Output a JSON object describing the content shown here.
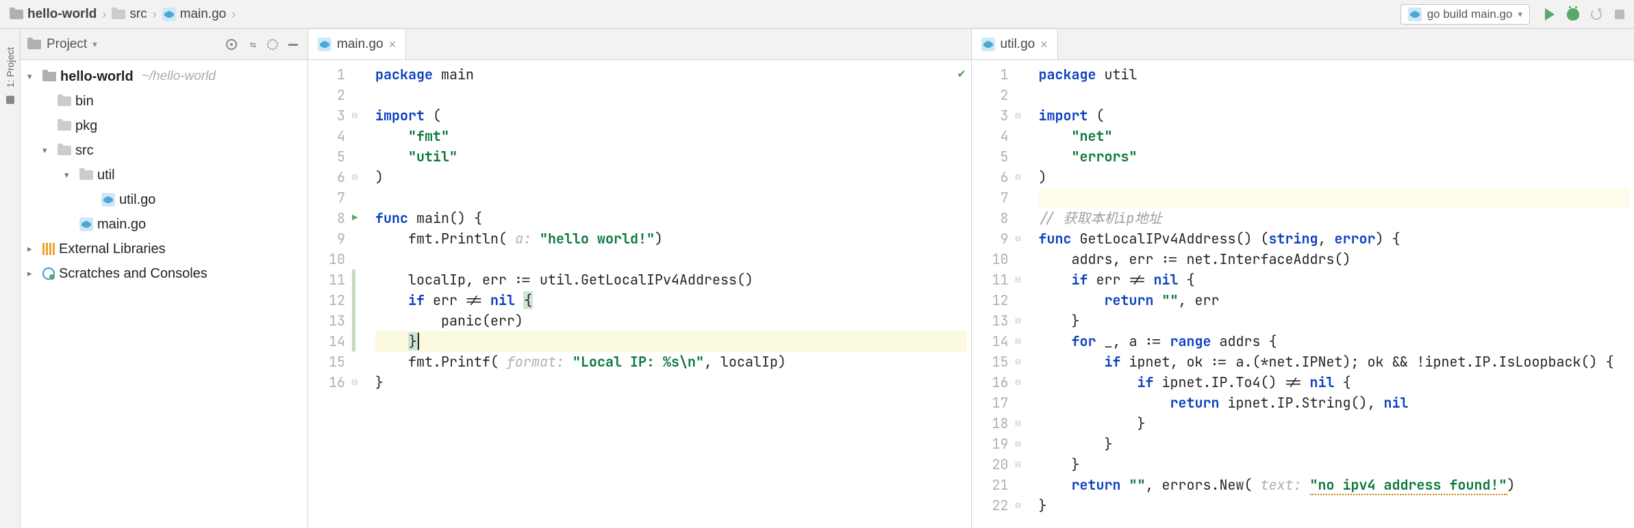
{
  "breadcrumbs": [
    {
      "label": "hello-world",
      "icon": "folder",
      "bold": true
    },
    {
      "label": "src",
      "icon": "folder",
      "bold": false
    },
    {
      "label": "main.go",
      "icon": "go",
      "bold": false
    }
  ],
  "run_config": {
    "label": "go build main.go",
    "icon": "go"
  },
  "toolbar_icons": [
    "play",
    "bug",
    "rerun",
    "stop"
  ],
  "gutter_tab": {
    "label": "1: Project"
  },
  "project_header": {
    "title": "Project"
  },
  "project_tree": [
    {
      "depth": 0,
      "arrow": "▾",
      "icon": "folder-dark",
      "name": "hello-world",
      "bold": true,
      "hint": "~/hello-world"
    },
    {
      "depth": 1,
      "arrow": "",
      "icon": "folder",
      "name": "bin"
    },
    {
      "depth": 1,
      "arrow": "",
      "icon": "folder",
      "name": "pkg"
    },
    {
      "depth": 1,
      "arrow": "▾",
      "icon": "folder",
      "name": "src"
    },
    {
      "depth": 2,
      "arrow": "▾",
      "icon": "folder",
      "name": "util"
    },
    {
      "depth": 3,
      "arrow": "",
      "icon": "go",
      "name": "util.go"
    },
    {
      "depth": 2,
      "arrow": "",
      "icon": "go",
      "name": "main.go"
    },
    {
      "depth": 0,
      "arrow": "▸",
      "icon": "lib",
      "name": "External Libraries"
    },
    {
      "depth": 0,
      "arrow": "▸",
      "icon": "scratch",
      "name": "Scratches and Consoles"
    }
  ],
  "editors": [
    {
      "tab": {
        "name": "main.go",
        "icon": "go"
      },
      "checkmark": true,
      "modif_range": [
        11,
        14
      ],
      "caret_line": 14,
      "run_mark_line": 8,
      "lines": [
        {
          "n": 1,
          "tokens": [
            [
              "kw",
              "package "
            ],
            [
              "pkg",
              "main"
            ]
          ]
        },
        {
          "n": 2,
          "tokens": []
        },
        {
          "n": 3,
          "fold": "-",
          "tokens": [
            [
              "kw",
              "import "
            ],
            [
              "",
              "("
            ]
          ]
        },
        {
          "n": 4,
          "tokens": [
            [
              "",
              "    "
            ],
            [
              "str",
              "\"fmt\""
            ]
          ]
        },
        {
          "n": 5,
          "tokens": [
            [
              "",
              "    "
            ],
            [
              "str",
              "\"util\""
            ]
          ]
        },
        {
          "n": 6,
          "fold": "-",
          "tokens": [
            [
              "",
              ")"
            ]
          ]
        },
        {
          "n": 7,
          "tokens": []
        },
        {
          "n": 8,
          "fold": "-",
          "tokens": [
            [
              "kw",
              "func "
            ],
            [
              "fn",
              "main"
            ],
            [
              "",
              "() {"
            ]
          ]
        },
        {
          "n": 9,
          "tokens": [
            [
              "",
              "    fmt.Println( "
            ],
            [
              "hint",
              "a: "
            ],
            [
              "str",
              "\"hello world!\""
            ],
            [
              "",
              ")"
            ]
          ]
        },
        {
          "n": 10,
          "tokens": []
        },
        {
          "n": 11,
          "tokens": [
            [
              "",
              "    localIp, err := util.GetLocalIPv4Address()"
            ]
          ]
        },
        {
          "n": 12,
          "tokens": [
            [
              "",
              "    "
            ],
            [
              "kw",
              "if "
            ],
            [
              "",
              "err != "
            ],
            [
              "kw",
              "nil "
            ],
            [
              "brace",
              "{"
            ]
          ]
        },
        {
          "n": 13,
          "tokens": [
            [
              "",
              "        panic(err)"
            ]
          ]
        },
        {
          "n": 14,
          "hl": true,
          "tokens": [
            [
              "",
              "    "
            ],
            [
              "brace caret",
              "}"
            ]
          ]
        },
        {
          "n": 15,
          "tokens": [
            [
              "",
              "    fmt.Printf( "
            ],
            [
              "hint",
              "format: "
            ],
            [
              "str",
              "\"Local IP: %s\\n\""
            ],
            [
              "",
              ", localIp)"
            ]
          ]
        },
        {
          "n": 16,
          "fold": "-",
          "tokens": [
            [
              "",
              "}"
            ]
          ]
        }
      ]
    },
    {
      "tab": {
        "name": "util.go",
        "icon": "go"
      },
      "checkmark": false,
      "caret_line": 0,
      "lines": [
        {
          "n": 1,
          "tokens": [
            [
              "kw",
              "package "
            ],
            [
              "pkg",
              "util"
            ]
          ]
        },
        {
          "n": 2,
          "tokens": []
        },
        {
          "n": 3,
          "fold": "-",
          "tokens": [
            [
              "kw",
              "import "
            ],
            [
              "",
              "("
            ]
          ]
        },
        {
          "n": 4,
          "tokens": [
            [
              "",
              "    "
            ],
            [
              "str",
              "\"net\""
            ]
          ]
        },
        {
          "n": 5,
          "tokens": [
            [
              "",
              "    "
            ],
            [
              "str",
              "\"errors\""
            ]
          ]
        },
        {
          "n": 6,
          "fold": "-",
          "tokens": [
            [
              "",
              ")"
            ]
          ]
        },
        {
          "n": 7,
          "hl": "soft",
          "tokens": []
        },
        {
          "n": 8,
          "tokens": [
            [
              "cmt",
              "// 获取本机ip地址"
            ]
          ]
        },
        {
          "n": 9,
          "fold": "-",
          "tokens": [
            [
              "kw",
              "func "
            ],
            [
              "fn",
              "GetLocalIPv4Address"
            ],
            [
              "",
              "() ("
            ],
            [
              "kw",
              "string"
            ],
            [
              "",
              ", "
            ],
            [
              "kw",
              "error"
            ],
            [
              "",
              ") {"
            ]
          ]
        },
        {
          "n": 10,
          "tokens": [
            [
              "",
              "    addrs, err := net.InterfaceAddrs()"
            ]
          ]
        },
        {
          "n": 11,
          "fold": "-",
          "tokens": [
            [
              "",
              "    "
            ],
            [
              "kw",
              "if "
            ],
            [
              "",
              "err != "
            ],
            [
              "kw",
              "nil"
            ],
            [
              "",
              " {"
            ]
          ]
        },
        {
          "n": 12,
          "tokens": [
            [
              "",
              "        "
            ],
            [
              "kw",
              "return "
            ],
            [
              "str",
              "\"\""
            ],
            [
              "",
              ", err"
            ]
          ]
        },
        {
          "n": 13,
          "fold": "-",
          "tokens": [
            [
              "",
              "    }"
            ]
          ]
        },
        {
          "n": 14,
          "fold": "-",
          "tokens": [
            [
              "",
              "    "
            ],
            [
              "kw",
              "for "
            ],
            [
              "",
              "_, a := "
            ],
            [
              "kw",
              "range "
            ],
            [
              "",
              "addrs {"
            ]
          ]
        },
        {
          "n": 15,
          "fold": "-",
          "tokens": [
            [
              "",
              "        "
            ],
            [
              "kw",
              "if "
            ],
            [
              "",
              "ipnet, ok := a.(*net.IPNet); ok && !ipnet.IP.IsLoopback() {"
            ]
          ]
        },
        {
          "n": 16,
          "fold": "-",
          "tokens": [
            [
              "",
              "            "
            ],
            [
              "kw",
              "if "
            ],
            [
              "",
              "ipnet.IP.To4() != "
            ],
            [
              "kw",
              "nil"
            ],
            [
              "",
              " {"
            ]
          ]
        },
        {
          "n": 17,
          "tokens": [
            [
              "",
              "                "
            ],
            [
              "kw",
              "return "
            ],
            [
              "",
              "ipnet.IP.String(), "
            ],
            [
              "kw",
              "nil"
            ]
          ]
        },
        {
          "n": 18,
          "fold": "-",
          "tokens": [
            [
              "",
              "            }"
            ]
          ]
        },
        {
          "n": 19,
          "fold": "-",
          "tokens": [
            [
              "",
              "        }"
            ]
          ]
        },
        {
          "n": 20,
          "fold": "-",
          "tokens": [
            [
              "",
              "    }"
            ]
          ]
        },
        {
          "n": 21,
          "tokens": [
            [
              "",
              "    "
            ],
            [
              "kw",
              "return "
            ],
            [
              "str",
              "\"\""
            ],
            [
              "",
              ", errors.New( "
            ],
            [
              "hint",
              "text: "
            ],
            [
              "str err-underline",
              "\"no ipv4 address found!\""
            ],
            [
              "",
              ")"
            ]
          ]
        },
        {
          "n": 22,
          "fold": "-",
          "tokens": [
            [
              "",
              "}"
            ]
          ]
        }
      ]
    }
  ]
}
